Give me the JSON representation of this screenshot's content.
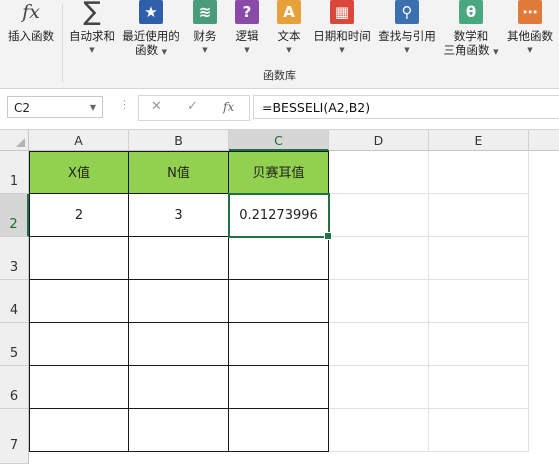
{
  "ribbon": {
    "items": [
      {
        "label": "插入函数",
        "icon": "fx-icon",
        "glyph": "fx",
        "color": "#f3f3f3"
      },
      {
        "label": "自动求和",
        "icon": "sigma-icon",
        "glyph": "∑",
        "color": "#f3f3f3"
      },
      {
        "label": "最近使用的",
        "label2": "函数",
        "icon": "star-book-icon",
        "glyph": "★",
        "color": "#2f5fa8"
      },
      {
        "label": "财务",
        "icon": "money-book-icon",
        "glyph": "≋",
        "color": "#4a9b7a"
      },
      {
        "label": "逻辑",
        "icon": "question-book-icon",
        "glyph": "?",
        "color": "#8a4aa8"
      },
      {
        "label": "文本",
        "icon": "text-book-icon",
        "glyph": "A",
        "color": "#e8a03a"
      },
      {
        "label": "日期和时间",
        "icon": "calendar-book-icon",
        "glyph": "▦",
        "color": "#d9483b"
      },
      {
        "label": "查找与引用",
        "icon": "magnifier-book-icon",
        "glyph": "⚲",
        "color": "#3a6fb0"
      },
      {
        "label": "数学和",
        "label2": "三角函数",
        "icon": "theta-book-icon",
        "glyph": "θ",
        "color": "#4aa880"
      },
      {
        "label": "其他函数",
        "icon": "more-book-icon",
        "glyph": "⋯",
        "color": "#e07a3a"
      }
    ],
    "group_label": "函数库"
  },
  "formula_bar": {
    "name_box": "C2",
    "cancel_glyph": "✕",
    "enter_glyph": "✓",
    "fx_glyph": "fx",
    "formula": "=BESSELI(A2,B2)"
  },
  "sheet": {
    "columns": [
      "A",
      "B",
      "C",
      "D",
      "E"
    ],
    "rows": [
      "1",
      "2",
      "3",
      "4",
      "5",
      "6",
      "7"
    ],
    "selected_column": "C",
    "selected_row": "2",
    "header_color": "#92d050",
    "cells": {
      "A1": "X值",
      "B1": "N值",
      "C1": "贝赛耳值",
      "A2": "2",
      "B2": "3",
      "C2": "0.21273996"
    }
  }
}
